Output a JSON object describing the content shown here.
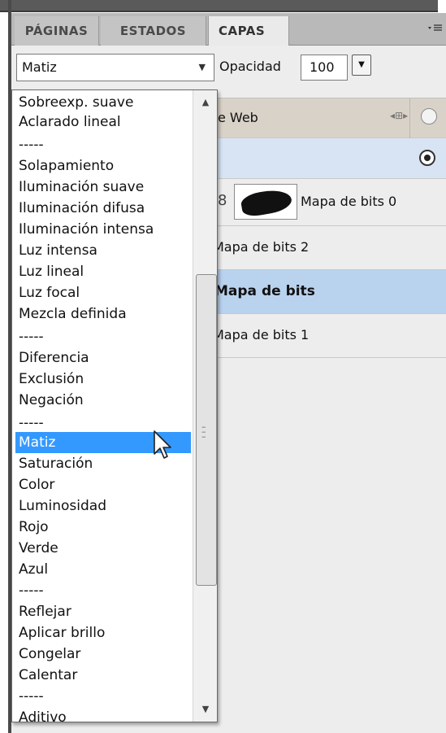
{
  "tabs": [
    {
      "label": "PÁGINAS",
      "active": false
    },
    {
      "label": "ESTADOS",
      "active": false
    },
    {
      "label": "CAPAS",
      "active": true
    }
  ],
  "panel_menu_icon": "panel-menu-icon",
  "blend_mode": {
    "value": "Matiz",
    "options": [
      "Sobreexp. suave",
      "Aclarado lineal",
      "-----",
      "Solapamiento",
      "Iluminación suave",
      "Iluminación difusa",
      "Iluminación intensa",
      "Luz intensa",
      "Luz lineal",
      "Luz focal",
      "Mezcla definida",
      "-----",
      "Diferencia",
      "Exclusión",
      "Negación",
      "-----",
      "Matiz",
      "Saturación",
      "Color",
      "Luminosidad",
      "Rojo",
      "Verde",
      "Azul",
      "-----",
      "Reflejar",
      "Aplicar brillo",
      "Congelar",
      "Calentar",
      "-----",
      "Aditivo"
    ],
    "selected_index": 16
  },
  "opacity": {
    "label": "Opacidad",
    "value": "100"
  },
  "layers": {
    "web": "e Web",
    "bitmap0": "Mapa de bits 0",
    "bitmap2": "Mapa de bits 2",
    "bitmap_selected": "Mapa de bits",
    "bitmap1": "Mapa de bits 1"
  },
  "colors": {
    "selection": "#3399ff",
    "layer_selected": "#b9d2ee",
    "web_row": "#d9d2c8",
    "sub_row": "#d8e4f4"
  }
}
